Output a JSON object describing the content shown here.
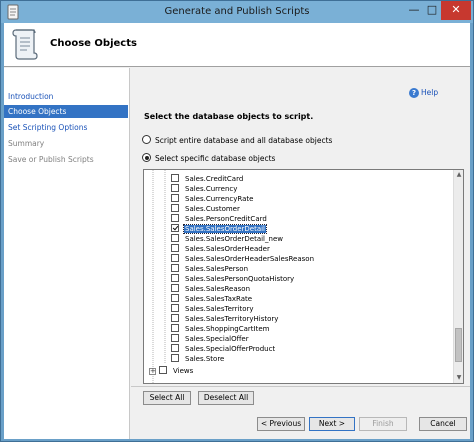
{
  "window": {
    "title": "Generate and Publish Scripts",
    "minimize_glyph": "—",
    "maximize_glyph": "□",
    "close_glyph": "✕"
  },
  "header": {
    "title": "Choose Objects"
  },
  "sidebar": {
    "items": [
      {
        "label": "Introduction",
        "state": "link"
      },
      {
        "label": "Choose Objects",
        "state": "active"
      },
      {
        "label": "Set Scripting Options",
        "state": "link"
      },
      {
        "label": "Summary",
        "state": "disabled"
      },
      {
        "label": "Save or Publish Scripts",
        "state": "disabled"
      }
    ]
  },
  "help": {
    "label": "Help",
    "glyph": "?"
  },
  "main": {
    "instruction": "Select the database objects to script.",
    "radio_entire": "Script entire database and all database objects",
    "radio_specific": "Select specific database objects",
    "selected_option": "specific"
  },
  "tree": {
    "items": [
      {
        "label": "Sales.CreditCard",
        "checked": false,
        "selected": false
      },
      {
        "label": "Sales.Currency",
        "checked": false,
        "selected": false
      },
      {
        "label": "Sales.CurrencyRate",
        "checked": false,
        "selected": false
      },
      {
        "label": "Sales.Customer",
        "checked": false,
        "selected": false
      },
      {
        "label": "Sales.PersonCreditCard",
        "checked": false,
        "selected": false
      },
      {
        "label": "Sales.SalesOrderDetail",
        "checked": true,
        "selected": true
      },
      {
        "label": "Sales.SalesOrderDetail_new",
        "checked": false,
        "selected": false
      },
      {
        "label": "Sales.SalesOrderHeader",
        "checked": false,
        "selected": false
      },
      {
        "label": "Sales.SalesOrderHeaderSalesReason",
        "checked": false,
        "selected": false
      },
      {
        "label": "Sales.SalesPerson",
        "checked": false,
        "selected": false
      },
      {
        "label": "Sales.SalesPersonQuotaHistory",
        "checked": false,
        "selected": false
      },
      {
        "label": "Sales.SalesReason",
        "checked": false,
        "selected": false
      },
      {
        "label": "Sales.SalesTaxRate",
        "checked": false,
        "selected": false
      },
      {
        "label": "Sales.SalesTerritory",
        "checked": false,
        "selected": false
      },
      {
        "label": "Sales.SalesTerritoryHistory",
        "checked": false,
        "selected": false
      },
      {
        "label": "Sales.ShoppingCartItem",
        "checked": false,
        "selected": false
      },
      {
        "label": "Sales.SpecialOffer",
        "checked": false,
        "selected": false
      },
      {
        "label": "Sales.SpecialOfferProduct",
        "checked": false,
        "selected": false
      },
      {
        "label": "Sales.Store",
        "checked": false,
        "selected": false
      }
    ],
    "folders": [
      {
        "label": "Views",
        "checked": false,
        "expander": "+"
      }
    ],
    "scroll_up_glyph": "▲",
    "scroll_down_glyph": "▼"
  },
  "selection_buttons": {
    "select_all": "Select All",
    "deselect_all": "Deselect All"
  },
  "nav_buttons": {
    "previous": "< Previous",
    "next": "Next >",
    "finish": "Finish",
    "cancel": "Cancel"
  },
  "colors": {
    "accent": "#3373c4",
    "link": "#1a52b8",
    "close": "#c7382f"
  }
}
